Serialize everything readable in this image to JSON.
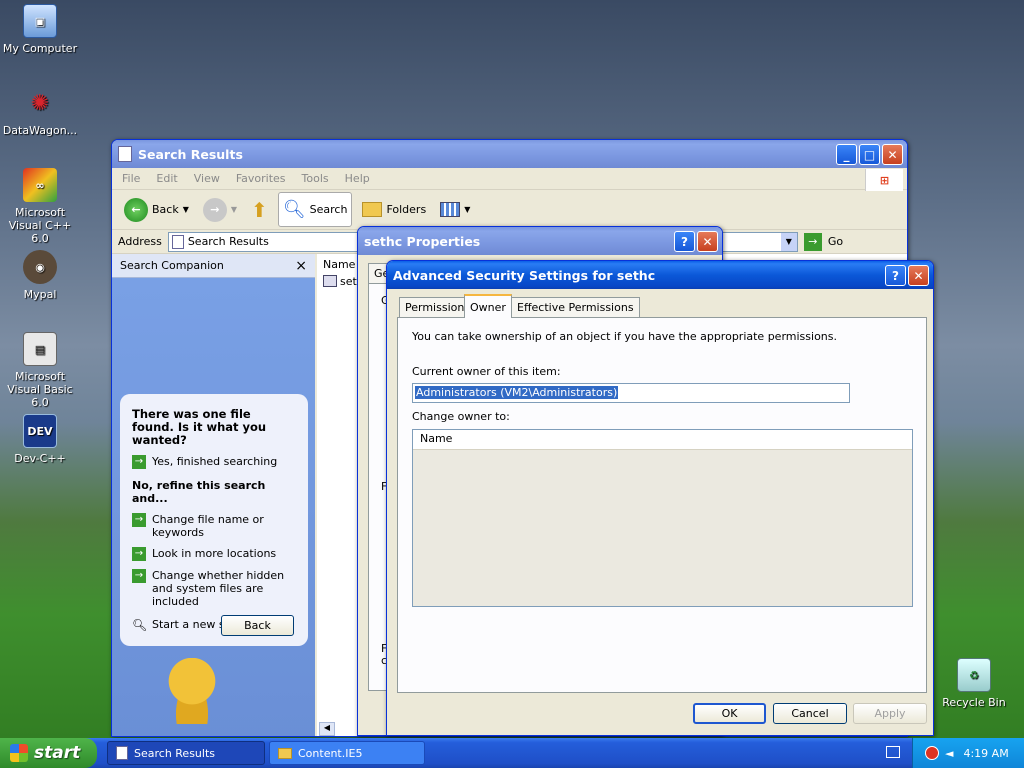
{
  "desktop": {
    "icons": [
      {
        "label": "My Computer"
      },
      {
        "label": "DataWagon..."
      },
      {
        "label": "Microsoft Visual C++ 6.0"
      },
      {
        "label": "Mypal"
      },
      {
        "label": "Microsoft Visual Basic 6.0"
      },
      {
        "label": "Dev-C++"
      },
      {
        "label": "Recycle Bin"
      }
    ]
  },
  "explorer": {
    "title": "Search Results",
    "menu": [
      "File",
      "Edit",
      "View",
      "Favorites",
      "Tools",
      "Help"
    ],
    "toolbar": {
      "back": "Back",
      "search": "Search",
      "folders": "Folders"
    },
    "address": {
      "label": "Address",
      "value": "Search Results",
      "go": "Go"
    },
    "companion": {
      "title": "Search Companion",
      "question": "There was one file found.  Is it what you wanted?",
      "yes": "Yes, finished searching",
      "refine_heading": "No, refine this search and...",
      "opt1": "Change file name or keywords",
      "opt2": "Look in more locations",
      "opt3": "Change whether hidden and system files are included",
      "new_search": "Start a new search",
      "back": "Back"
    },
    "list": {
      "col_name": "Name",
      "row1": "seth"
    }
  },
  "props": {
    "title": "sethc Properties",
    "tab": "Ge",
    "frag1": "G",
    "frag2": "F",
    "frag3": "F",
    "frag4": "c"
  },
  "adv": {
    "title": "Advanced Security Settings for sethc",
    "tabs": [
      "Permissions",
      "Owner",
      "Effective Permissions"
    ],
    "intro": "You can take ownership of an object if you have the appropriate permissions.",
    "current_label": "Current owner of this item:",
    "current_value": "Administrators (VM2\\Administrators)",
    "change_label": "Change owner to:",
    "col_name": "Name",
    "ok": "OK",
    "cancel": "Cancel",
    "apply": "Apply"
  },
  "taskbar": {
    "start": "start",
    "items": [
      "Search Results",
      "Content.IE5"
    ],
    "clock": "4:19 AM"
  },
  "colors": {
    "xp_blue": "#0a5fe8",
    "start_green": "#3a9b2f",
    "taskbar": "#245edb"
  }
}
